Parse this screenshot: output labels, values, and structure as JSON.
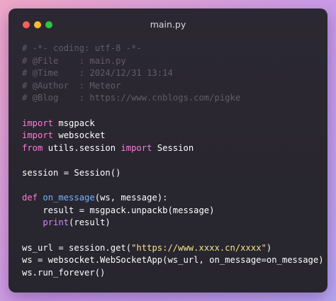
{
  "window": {
    "title": "main.py",
    "traffic_lights": [
      "close",
      "minimize",
      "maximize"
    ]
  },
  "code_lines": [
    [
      {
        "t": "# -*- coding: utf-8 -*-",
        "c": "cm"
      }
    ],
    [
      {
        "t": "# @File    : main.py",
        "c": "cm"
      }
    ],
    [
      {
        "t": "# @Time    : 2024/12/31 13:14",
        "c": "cm"
      }
    ],
    [
      {
        "t": "# @Author  : Meteor",
        "c": "cm"
      }
    ],
    [
      {
        "t": "# @Blog    : https://www.cnblogs.com/pigke",
        "c": "cm"
      }
    ],
    [],
    [
      {
        "t": "import",
        "c": "kw"
      },
      {
        "t": " msgpack",
        "c": "tx"
      }
    ],
    [
      {
        "t": "import",
        "c": "kw"
      },
      {
        "t": " websocket",
        "c": "tx"
      }
    ],
    [
      {
        "t": "from",
        "c": "kw"
      },
      {
        "t": " utils.session ",
        "c": "tx"
      },
      {
        "t": "import",
        "c": "kw"
      },
      {
        "t": " Session",
        "c": "tx"
      }
    ],
    [],
    [
      {
        "t": "session = Session()",
        "c": "tx"
      }
    ],
    [],
    [
      {
        "t": "def",
        "c": "kw"
      },
      {
        "t": " ",
        "c": "tx"
      },
      {
        "t": "on_message",
        "c": "fn"
      },
      {
        "t": "(ws, message):",
        "c": "tx"
      }
    ],
    [
      {
        "t": "    result = msgpack.unpackb(message)",
        "c": "tx"
      }
    ],
    [
      {
        "t": "    ",
        "c": "tx"
      },
      {
        "t": "print",
        "c": "bi"
      },
      {
        "t": "(result)",
        "c": "tx"
      }
    ],
    [],
    [
      {
        "t": "ws_url = session.get(",
        "c": "tx"
      },
      {
        "t": "\"https://www.xxxx.cn/xxxx\"",
        "c": "st"
      },
      {
        "t": ")",
        "c": "tx"
      }
    ],
    [
      {
        "t": "ws = websocket.WebSocketApp(ws_url, on_message=on_message)",
        "c": "tx"
      }
    ],
    [
      {
        "t": "ws.run_forever()",
        "c": "tx"
      }
    ]
  ],
  "colors": {
    "background_gradient_start": "#f0a8c8",
    "background_gradient_end": "#b7a6f2",
    "window_bg": "#2b2833",
    "comment": "#615c69",
    "keyword": "#ff7ad9",
    "function_name": "#6fb7ff",
    "builtin": "#d18cff",
    "string": "#f6e58d",
    "text": "#ffffff"
  }
}
